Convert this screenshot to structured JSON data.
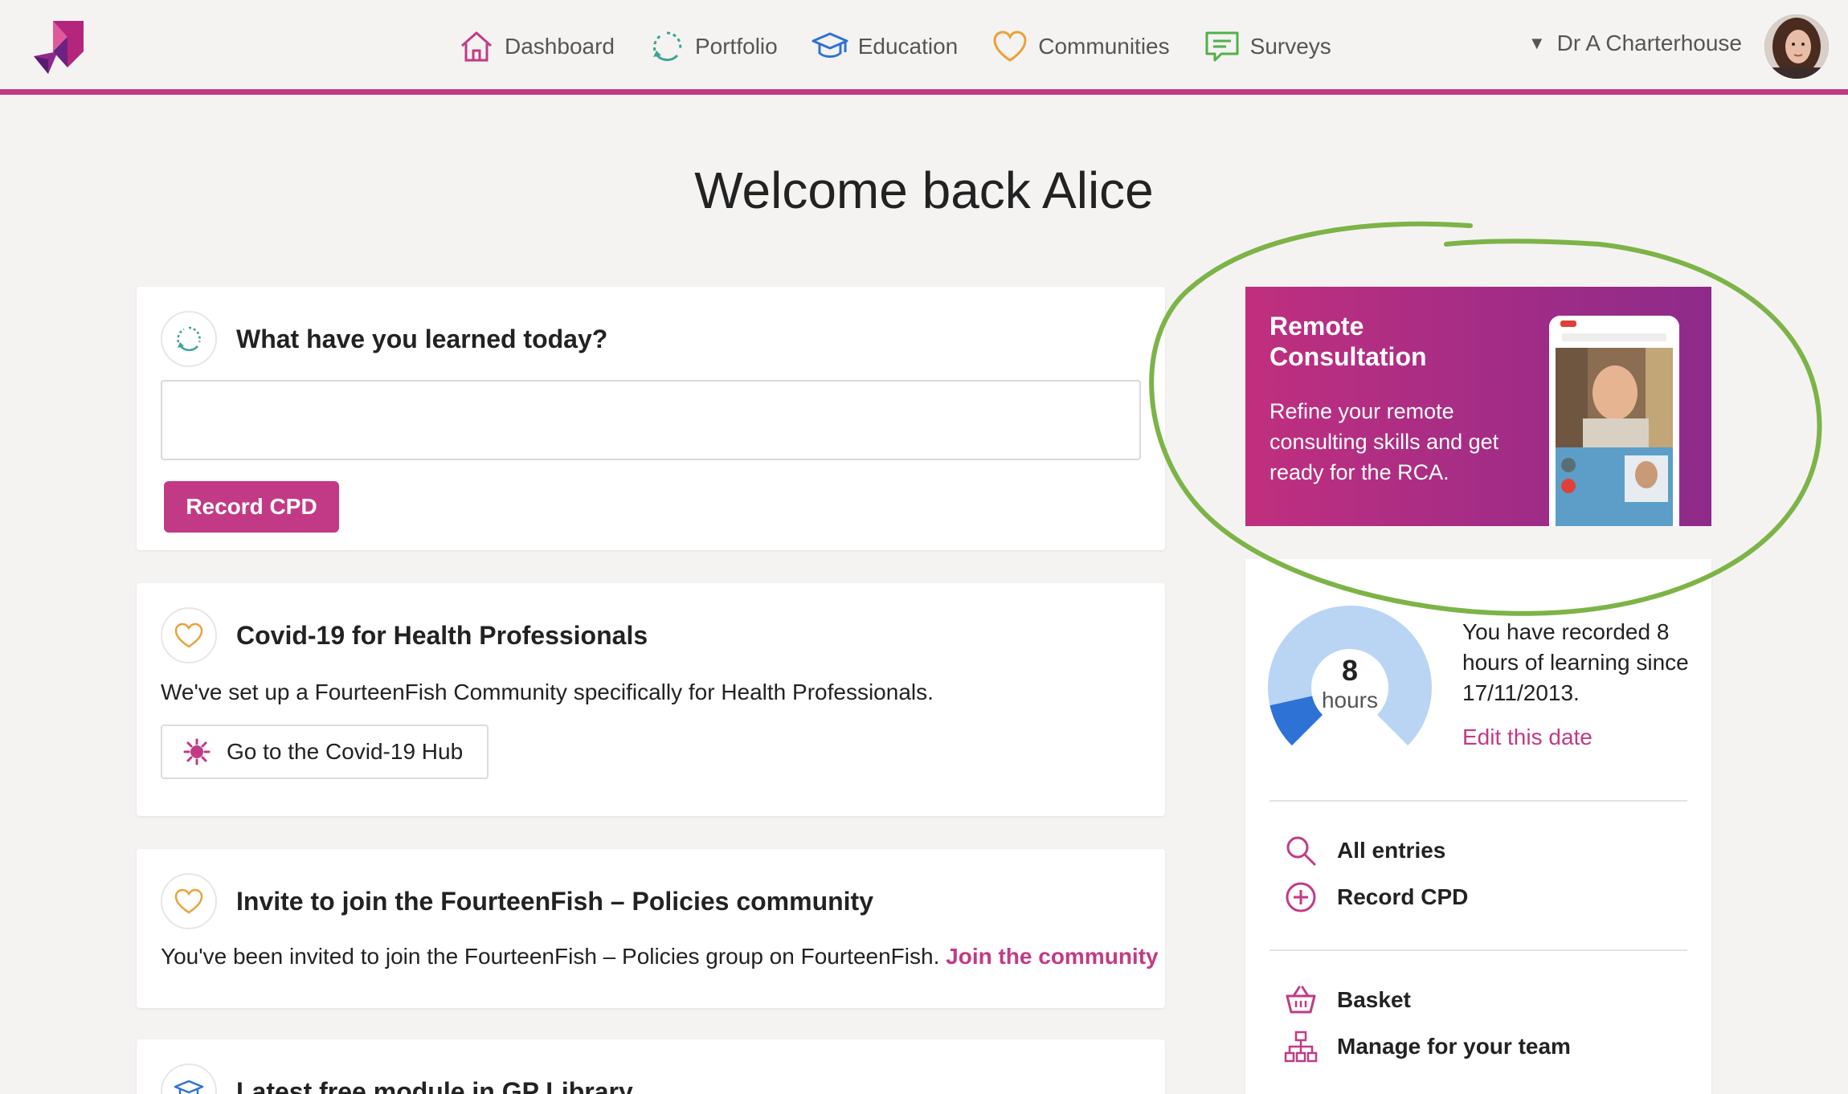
{
  "header": {
    "nav": [
      {
        "label": "Dashboard",
        "icon": "home-icon"
      },
      {
        "label": "Portfolio",
        "icon": "portfolio-icon"
      },
      {
        "label": "Education",
        "icon": "graduation-cap-icon"
      },
      {
        "label": "Communities",
        "icon": "heart-icon"
      },
      {
        "label": "Surveys",
        "icon": "chat-bubble-icon"
      }
    ],
    "user_name": "Dr A Charterhouse"
  },
  "page_title": "Welcome back Alice",
  "learn_card": {
    "title": "What have you learned today?",
    "input_value": "",
    "button_label": "Record CPD"
  },
  "covid_card": {
    "title": "Covid-19 for Health Professionals",
    "text": "We've set up a FourteenFish Community specifically for Health Professionals.",
    "button_label": "Go to the Covid-19 Hub"
  },
  "invite_card": {
    "title": "Invite to join the FourteenFish – Policies community",
    "text": "You've been invited to join the FourteenFish – Policies group on FourteenFish.",
    "link_label": "Join the community"
  },
  "library_card": {
    "title": "Latest free module in GP Library"
  },
  "promo": {
    "title": "Remote Consultation",
    "text": "Refine your remote consulting skills and get ready for the RCA."
  },
  "stats": {
    "hours_value": 8,
    "hours_number": "8",
    "hours_unit": "hours",
    "summary": "You have recorded 8 hours of learning since 17/11/2013.",
    "edit_link": "Edit this date",
    "donut_fill_fraction": 0.12
  },
  "stats_menu": {
    "all_entries": "All entries",
    "record_cpd": "Record CPD",
    "basket": "Basket",
    "manage_team": "Manage for your team"
  },
  "colors": {
    "brand": "#c23a86",
    "annotation": "#7db347",
    "donut_track": "#b9d5f3",
    "donut_fill": "#2f72d6"
  }
}
